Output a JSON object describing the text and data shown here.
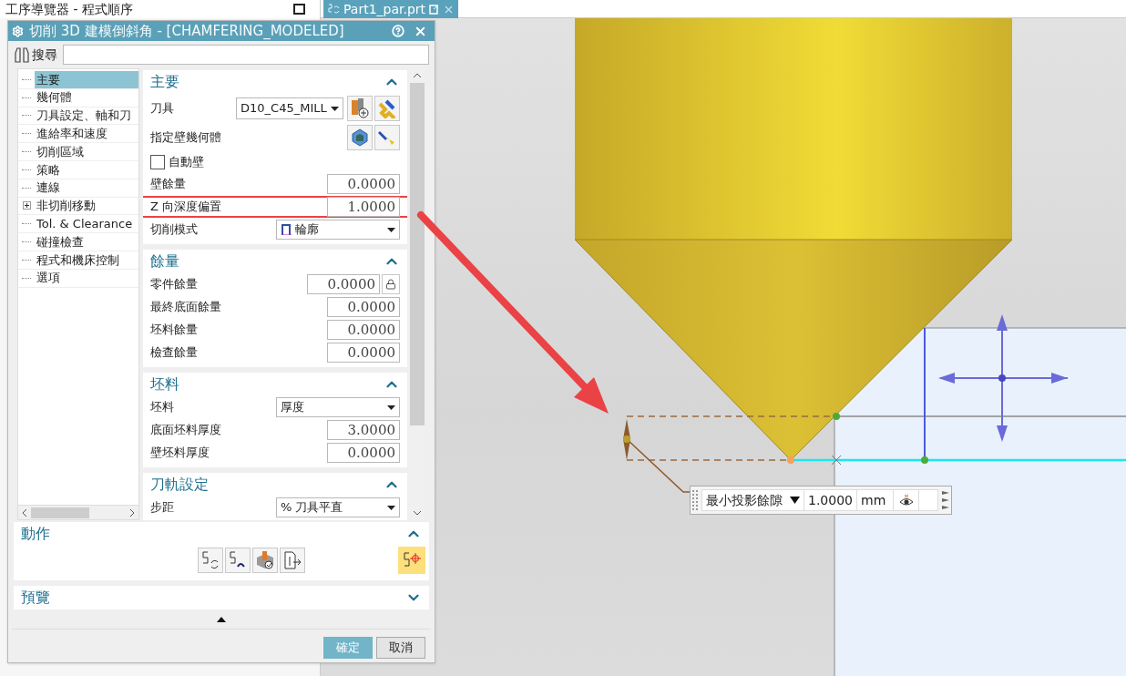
{
  "navigator": {
    "title": "工序導覽器 - 程式順序"
  },
  "file_tab": {
    "label": "Part1_par.prt"
  },
  "dialog": {
    "title": "切削 3D 建模倒斜角 - [CHAMFERING_MODELED]",
    "search_label": "搜尋",
    "tree": [
      {
        "label": "主要",
        "selected": true,
        "expander": false
      },
      {
        "label": "幾何體",
        "selected": false,
        "expander": false
      },
      {
        "label": "刀具設定、軸和刀",
        "selected": false,
        "expander": false
      },
      {
        "label": "進給率和速度",
        "selected": false,
        "expander": false
      },
      {
        "label": "切削區域",
        "selected": false,
        "expander": false
      },
      {
        "label": "策略",
        "selected": false,
        "expander": false
      },
      {
        "label": "連線",
        "selected": false,
        "expander": false
      },
      {
        "label": "非切削移動",
        "selected": false,
        "expander": true
      },
      {
        "label": "Tol. & Clearance",
        "selected": false,
        "expander": false
      },
      {
        "label": "碰撞檢查",
        "selected": false,
        "expander": false
      },
      {
        "label": "程式和機床控制",
        "selected": false,
        "expander": false
      },
      {
        "label": "選項",
        "selected": false,
        "expander": false
      }
    ],
    "sections": [
      {
        "title": "主要",
        "expanded": true,
        "rows": [
          {
            "kind": "tool_select",
            "label": "刀具",
            "value": "D10_C45_MILL"
          },
          {
            "kind": "geometry",
            "label": "指定壁幾何體"
          },
          {
            "kind": "checkbox",
            "label": "自動壁",
            "checked": false
          },
          {
            "kind": "number",
            "label": "壁餘量",
            "value": "0.0000",
            "highlighted": false
          },
          {
            "kind": "number",
            "label": "Z 向深度偏置",
            "value": "1.0000",
            "highlighted": true
          },
          {
            "kind": "select_icon",
            "label": "切削模式",
            "value": "輪廓"
          }
        ]
      },
      {
        "title": "餘量",
        "expanded": true,
        "rows": [
          {
            "kind": "number_lock",
            "label": "零件餘量",
            "value": "0.0000"
          },
          {
            "kind": "number",
            "label": "最終底面餘量",
            "value": "0.0000",
            "highlighted": false
          },
          {
            "kind": "number",
            "label": "坯料餘量",
            "value": "0.0000",
            "highlighted": false
          },
          {
            "kind": "number",
            "label": "檢查餘量",
            "value": "0.0000",
            "highlighted": false
          }
        ]
      },
      {
        "title": "坯料",
        "expanded": true,
        "rows": [
          {
            "kind": "select",
            "label": "坯料",
            "value": "厚度"
          },
          {
            "kind": "number",
            "label": "底面坯料厚度",
            "value": "3.0000",
            "highlighted": false
          },
          {
            "kind": "number",
            "label": "壁坯料厚度",
            "value": "0.0000",
            "highlighted": false
          }
        ]
      },
      {
        "title": "刀軌設定",
        "expanded": true,
        "rows": [
          {
            "kind": "select",
            "label": "步距",
            "value": "% 刀具平直"
          }
        ]
      }
    ],
    "action_section": {
      "title": "動作",
      "expanded": true
    },
    "preview_section": {
      "title": "預覽",
      "expanded": false
    },
    "buttons": [
      {
        "label": "確定",
        "kind": "primary"
      },
      {
        "label": "取消",
        "kind": "secondary"
      }
    ]
  },
  "annotation_toolbar": {
    "label": "最小投影餘隙",
    "value": "1.0000",
    "unit": "mm"
  }
}
